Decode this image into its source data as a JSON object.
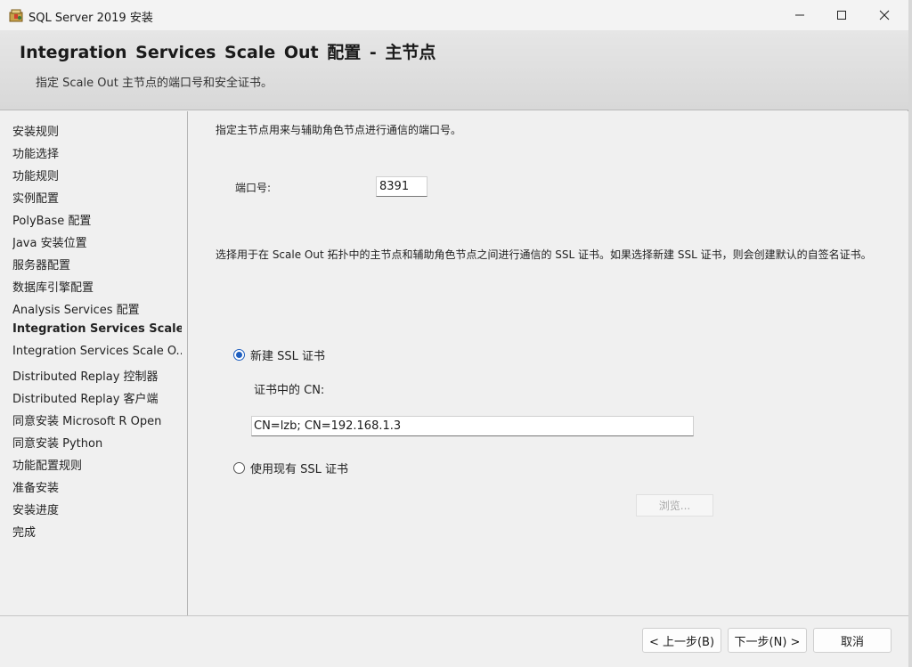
{
  "window": {
    "title": "SQL Server 2019 安装"
  },
  "header": {
    "title": "Integration Services Scale Out 配置 - 主节点",
    "subtitle": "指定 Scale Out 主节点的端口号和安全证书。"
  },
  "sidebar": {
    "items": [
      {
        "label": "安装规则",
        "active": false
      },
      {
        "label": "功能选择",
        "active": false
      },
      {
        "label": "功能规则",
        "active": false
      },
      {
        "label": "实例配置",
        "active": false
      },
      {
        "label": "PolyBase 配置",
        "active": false
      },
      {
        "label": "Java 安装位置",
        "active": false
      },
      {
        "label": "服务器配置",
        "active": false
      },
      {
        "label": "数据库引擎配置",
        "active": false
      },
      {
        "label": "Analysis Services 配置",
        "active": false
      },
      {
        "label": "Integration Services Scale ...",
        "active": true
      },
      {
        "label": "Integration Services Scale O...",
        "active": false
      },
      {
        "label": "Distributed Replay 控制器",
        "active": false
      },
      {
        "label": "Distributed Replay 客户端",
        "active": false
      },
      {
        "label": "同意安装 Microsoft R Open",
        "active": false
      },
      {
        "label": "同意安装 Python",
        "active": false
      },
      {
        "label": "功能配置规则",
        "active": false
      },
      {
        "label": "准备安装",
        "active": false
      },
      {
        "label": "安装进度",
        "active": false
      },
      {
        "label": "完成",
        "active": false
      }
    ]
  },
  "main": {
    "port_description": "指定主节点用来与辅助角色节点进行通信的端口号。",
    "port_label": "端口号:",
    "port_value": "8391",
    "cert_description": "选择用于在 Scale Out 拓扑中的主节点和辅助角色节点之间进行通信的 SSL 证书。如果选择新建 SSL 证书，则会创建默认的自签名证书。",
    "new_cert_label": "新建 SSL 证书",
    "new_cert_selected": true,
    "cn_label": "证书中的 CN:",
    "cn_value": "CN=lzb; CN=192.168.1.3",
    "existing_cert_label": "使用现有 SSL 证书",
    "existing_cert_selected": false,
    "browse_label": "浏览..."
  },
  "footer": {
    "back_label": "< 上一步(B)",
    "next_label": "下一步(N) >",
    "cancel_label": "取消"
  }
}
